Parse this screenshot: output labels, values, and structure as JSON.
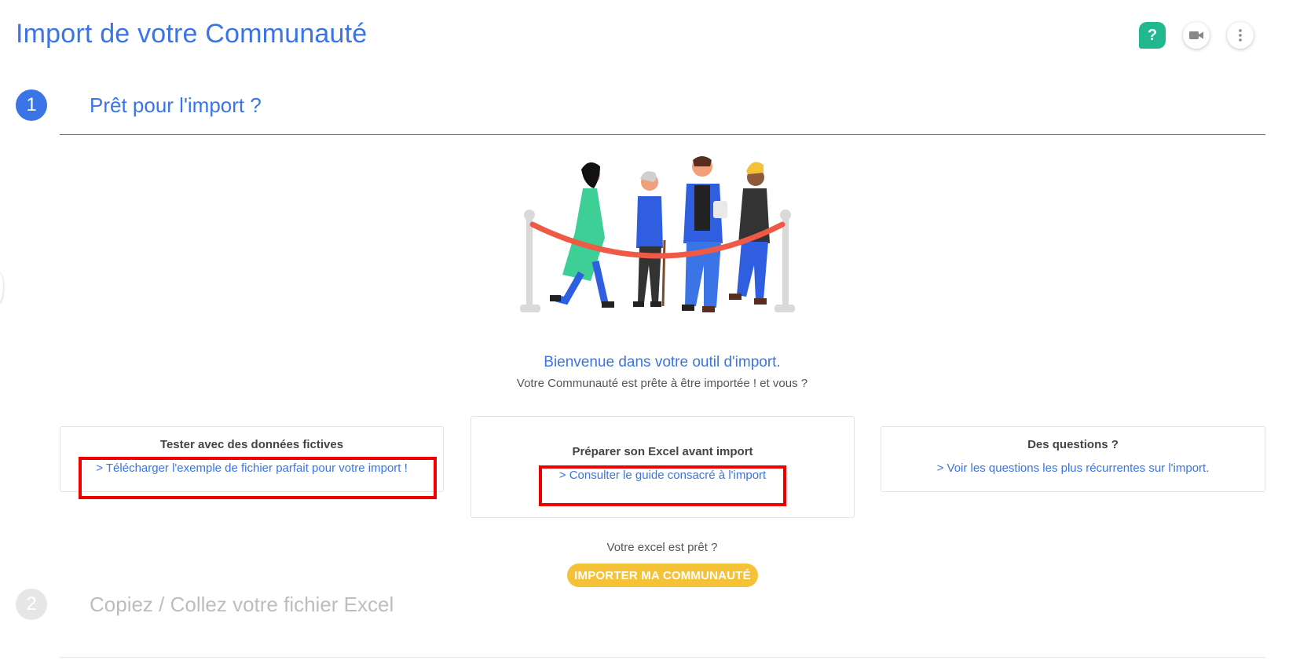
{
  "header": {
    "title": "Import de votre Communauté",
    "actions": {
      "help_label": "?",
      "help_color": "#21b88f",
      "video_icon": "video-camera-icon",
      "more_icon": "more-vertical-icon"
    }
  },
  "steps": [
    {
      "number": "1",
      "title": "Prêt pour l'import ?",
      "state": "active"
    },
    {
      "number": "2",
      "title": "Copiez / Collez votre fichier Excel",
      "state": "inactive"
    }
  ],
  "welcome": {
    "title": "Bienvenue dans votre outil d'import.",
    "subtitle": "Votre Communauté est prête à être importée ! et vous ?"
  },
  "cards": [
    {
      "title": "Tester avec des données fictives",
      "link": "> Télécharger l'exemple de fichier parfait pour votre import !"
    },
    {
      "title": "Préparer son Excel avant import",
      "link": "> Consulter le guide consacré à l'import"
    },
    {
      "title": "Des questions ?",
      "link": "> Voir les questions les plus récurrentes sur l'import."
    }
  ],
  "cta": {
    "prompt": "Votre excel est prêt ?",
    "button_label": "IMPORTER MA COMMUNAUTÉ",
    "button_color": "#f5c137"
  },
  "colors": {
    "accent": "#3a74e6",
    "highlight": "#ee0000"
  }
}
